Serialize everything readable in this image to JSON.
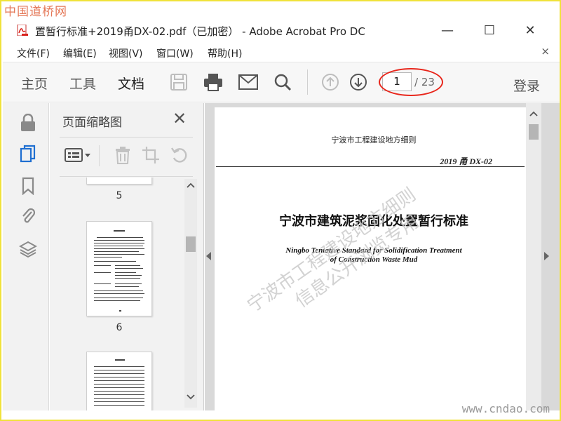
{
  "site_watermark_top": "中国道桥网",
  "site_watermark_bottom": "www.cndao.com",
  "window": {
    "title": "置暂行标准+2019甬DX-02.pdf（已加密） - Adobe Acrobat Pro DC",
    "minimize_glyph": "—",
    "maximize_glyph": "☐",
    "close_glyph": "✕"
  },
  "menu": {
    "items": [
      "文件(F)",
      "编辑(E)",
      "视图(V)",
      "窗口(W)",
      "帮助(H)"
    ],
    "close_glyph": "×"
  },
  "toolbar": {
    "tabs": [
      "主页",
      "工具",
      "文档"
    ],
    "active_tab": "文档",
    "icons": [
      "save-icon",
      "print-icon",
      "mail-icon",
      "search-icon",
      "page-up-icon",
      "page-down-icon"
    ],
    "current_page": "1",
    "total_pages": "/ 23",
    "login_label": "登录",
    "highlight_color": "#e8261b"
  },
  "rail": {
    "icons": [
      "lock-icon",
      "pages-icon",
      "bookmark-icon",
      "attachment-icon",
      "layers-icon"
    ]
  },
  "thumbnail_panel": {
    "title": "页面缩略图",
    "close_glyph": "✕",
    "tool_icons": [
      "thumbnail-options-icon",
      "delete-icon",
      "crop-icon",
      "rotate-icon"
    ],
    "pages": [
      "5",
      "6"
    ]
  },
  "document": {
    "header": "宁波市工程建设地方细则",
    "code": "2019 甬  DX-02",
    "title": "宁波市建筑泥浆固化处置暂行标准",
    "english_title_line1": "Ningbo Tentative Standard for Solidification Treatment",
    "english_title_line2": "of Construction Waste Mud",
    "watermark_line1": "宁波市工程建设地方细则",
    "watermark_line2": "信息公开浏览专用"
  }
}
